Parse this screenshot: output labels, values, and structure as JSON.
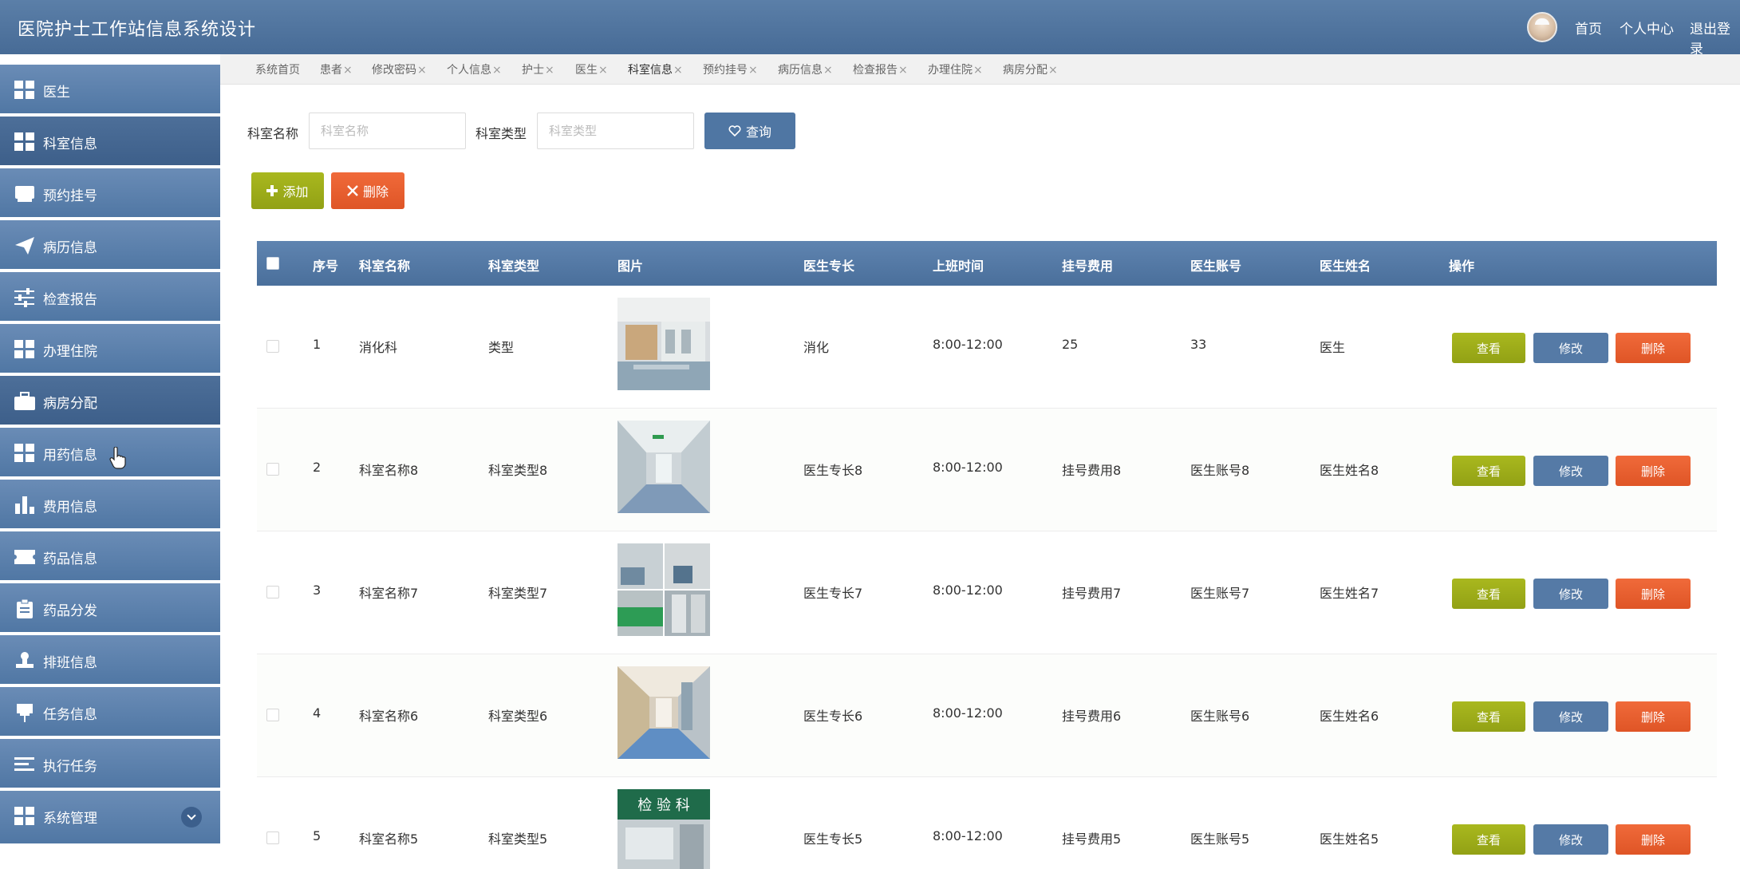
{
  "header": {
    "title": "医院护士工作站信息系统设计",
    "nav": [
      "首页",
      "个人中心",
      "退出登录"
    ]
  },
  "sidebar": {
    "items": [
      {
        "label": "医生",
        "icon": "grid-icon"
      },
      {
        "label": "科室信息",
        "icon": "grid-icon"
      },
      {
        "label": "预约挂号",
        "icon": "inbox-icon"
      },
      {
        "label": "病历信息",
        "icon": "paper-plane-icon"
      },
      {
        "label": "检查报告",
        "icon": "sliders-icon"
      },
      {
        "label": "办理住院",
        "icon": "grid-icon"
      },
      {
        "label": "病房分配",
        "icon": "briefcase-icon"
      },
      {
        "label": "用药信息",
        "icon": "grid-icon"
      },
      {
        "label": "费用信息",
        "icon": "bar-chart-icon"
      },
      {
        "label": "药品信息",
        "icon": "ticket-icon"
      },
      {
        "label": "药品分发",
        "icon": "clipboard-icon"
      },
      {
        "label": "排班信息",
        "icon": "stamp-icon"
      },
      {
        "label": "任务信息",
        "icon": "pushpin-icon"
      },
      {
        "label": "执行任务",
        "icon": "list-icon"
      },
      {
        "label": "系统管理",
        "icon": "grid-icon"
      }
    ]
  },
  "tabs": [
    {
      "label": "系统首页",
      "close": ""
    },
    {
      "label": "患者",
      "close": "×"
    },
    {
      "label": "修改密码",
      "close": "×"
    },
    {
      "label": "个人信息",
      "close": "×"
    },
    {
      "label": "护士",
      "close": "×"
    },
    {
      "label": "医生",
      "close": "×"
    },
    {
      "label": "科室信息",
      "close": "×"
    },
    {
      "label": "预约挂号",
      "close": "×"
    },
    {
      "label": "病历信息",
      "close": "×"
    },
    {
      "label": "检查报告",
      "close": "×"
    },
    {
      "label": "办理住院",
      "close": "×"
    },
    {
      "label": "病房分配",
      "close": "×"
    }
  ],
  "search": {
    "name_label": "科室名称",
    "name_placeholder": "科室名称",
    "type_label": "科室类型",
    "type_placeholder": "科室类型",
    "query_label": "查询"
  },
  "toolbar": {
    "add_label": "添加",
    "delete_label": "删除"
  },
  "table": {
    "headers": [
      "序号",
      "科室名称",
      "科室类型",
      "图片",
      "医生专长",
      "上班时间",
      "挂号费用",
      "医生账号",
      "医生姓名",
      "操作"
    ],
    "rows": [
      {
        "no": "1",
        "name": "消化科",
        "type": "类型",
        "specialty": "消化",
        "time": "8:00-12:00",
        "fee": "25",
        "account": "33",
        "doctor": "医生"
      },
      {
        "no": "2",
        "name": "科室名称8",
        "type": "科室类型8",
        "specialty": "医生专长8",
        "time": "8:00-12:00",
        "fee": "挂号费用8",
        "account": "医生账号8",
        "doctor": "医生姓名8"
      },
      {
        "no": "3",
        "name": "科室名称7",
        "type": "科室类型7",
        "specialty": "医生专长7",
        "time": "8:00-12:00",
        "fee": "挂号费用7",
        "account": "医生账号7",
        "doctor": "医生姓名7"
      },
      {
        "no": "4",
        "name": "科室名称6",
        "type": "科室类型6",
        "specialty": "医生专长6",
        "time": "8:00-12:00",
        "fee": "挂号费用6",
        "account": "医生账号6",
        "doctor": "医生姓名6"
      },
      {
        "no": "5",
        "name": "科室名称5",
        "type": "科室类型5",
        "specialty": "医生专长5",
        "time": "8:00-12:00",
        "fee": "挂号费用5",
        "account": "医生账号5",
        "doctor": "医生姓名5"
      }
    ],
    "actions": {
      "view": "查看",
      "edit": "修改",
      "delete": "删除"
    },
    "sign_text": "检 验 科"
  },
  "colors": {
    "header": "#4d72a0",
    "sidebar": "#5d82ae",
    "sidebar_active": "#45678f",
    "add_green": "#9cab1a",
    "delete_orange": "#e85c2d",
    "edit_blue": "#557aa6"
  }
}
